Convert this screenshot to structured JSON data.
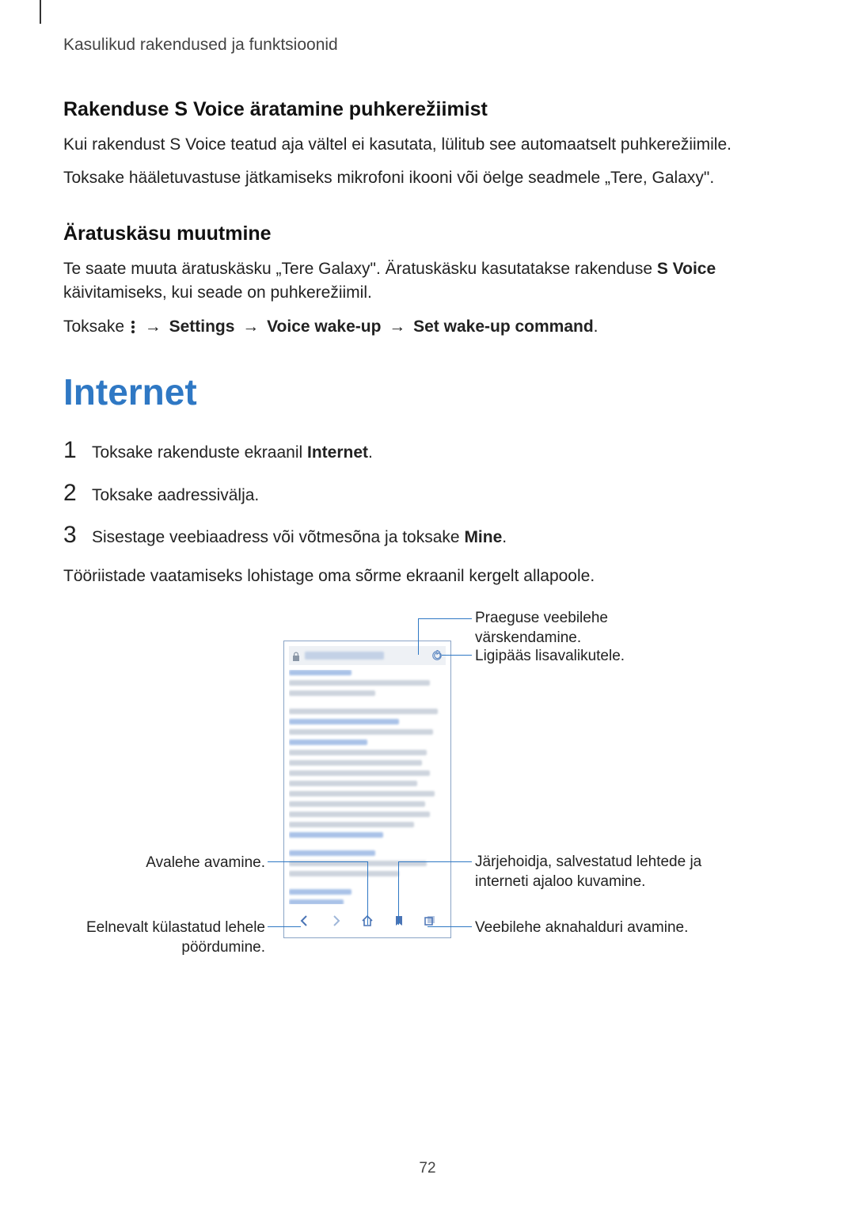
{
  "runningHead": "Kasulikud rakendused ja funktsioonid",
  "svoice": {
    "wakeHeading": "Rakenduse S Voice äratamine puhkerežiimist",
    "wakeP1": "Kui rakendust S Voice teatud aja vältel ei kasutata, lülitub see automaatselt puhkerežiimile.",
    "wakeP2": "Toksake hääletuvastuse jätkamiseks mikrofoni ikooni või öelge seadmele „Tere, Galaxy\".",
    "changeHeading": "Äratuskäsu muutmine",
    "changeP1a": "Te saate muuta äratuskäsku „Tere Galaxy\". Äratuskäsku kasutatakse rakenduse ",
    "changeP1b": "S Voice",
    "changeP1c": " käivitamiseks, kui seade on puhkerežiimil.",
    "tapPrefix": "Toksake ",
    "arrow": "→",
    "menuSettings": "Settings",
    "menuVoiceWake": "Voice wake-up",
    "menuSetCmd": "Set wake-up command",
    "period": "."
  },
  "internet": {
    "heading": "Internet",
    "steps": [
      {
        "num": "1",
        "pre": "Toksake rakenduste ekraanil ",
        "bold": "Internet",
        "post": "."
      },
      {
        "num": "2",
        "pre": "Toksake aadressivälja.",
        "bold": "",
        "post": ""
      },
      {
        "num": "3",
        "pre": "Sisestage veebiaadress või võtmesõna ja toksake ",
        "bold": "Mine",
        "post": "."
      }
    ],
    "afterSteps": "Tööriistade vaatamiseks lohistage oma sõrme ekraanil kergelt allapoole."
  },
  "callouts": {
    "refresh": "Praeguse veebilehe värskendamine.",
    "more": "Ligipääs lisavalikutele.",
    "bookmarks": "Järjehoidja, salvestatud lehtede ja interneti ajaloo kuvamine.",
    "windows": "Veebilehe aknahalduri avamine.",
    "home": "Avalehe avamine.",
    "back": "Eelnevalt külastatud lehele pöördumine."
  },
  "pageNumber": "72"
}
